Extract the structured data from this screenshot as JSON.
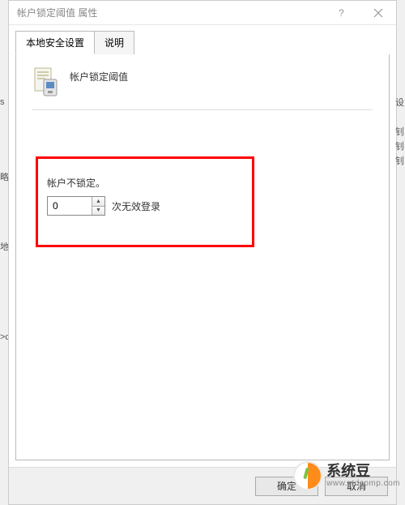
{
  "titlebar": {
    "title": "帐户锁定阈值 属性"
  },
  "tabs": {
    "tab_local_security": "本地安全设置",
    "tab_description": "说明"
  },
  "policy": {
    "heading": "帐户锁定阈值"
  },
  "setting": {
    "not_locked_label": "帐户不锁定。",
    "value": "0",
    "suffix": "次无效登录"
  },
  "buttons": {
    "ok": "确定",
    "cancel": "取消"
  },
  "watermark": {
    "brand": "系统豆",
    "url": "www.xtdcomp.com"
  },
  "bg": {
    "f1": "s",
    "f2": "略",
    "f3": "地",
    "f4": ">cs",
    "f5": "设",
    "f6": "钊",
    "f7": "钊",
    "f8": "钊"
  }
}
